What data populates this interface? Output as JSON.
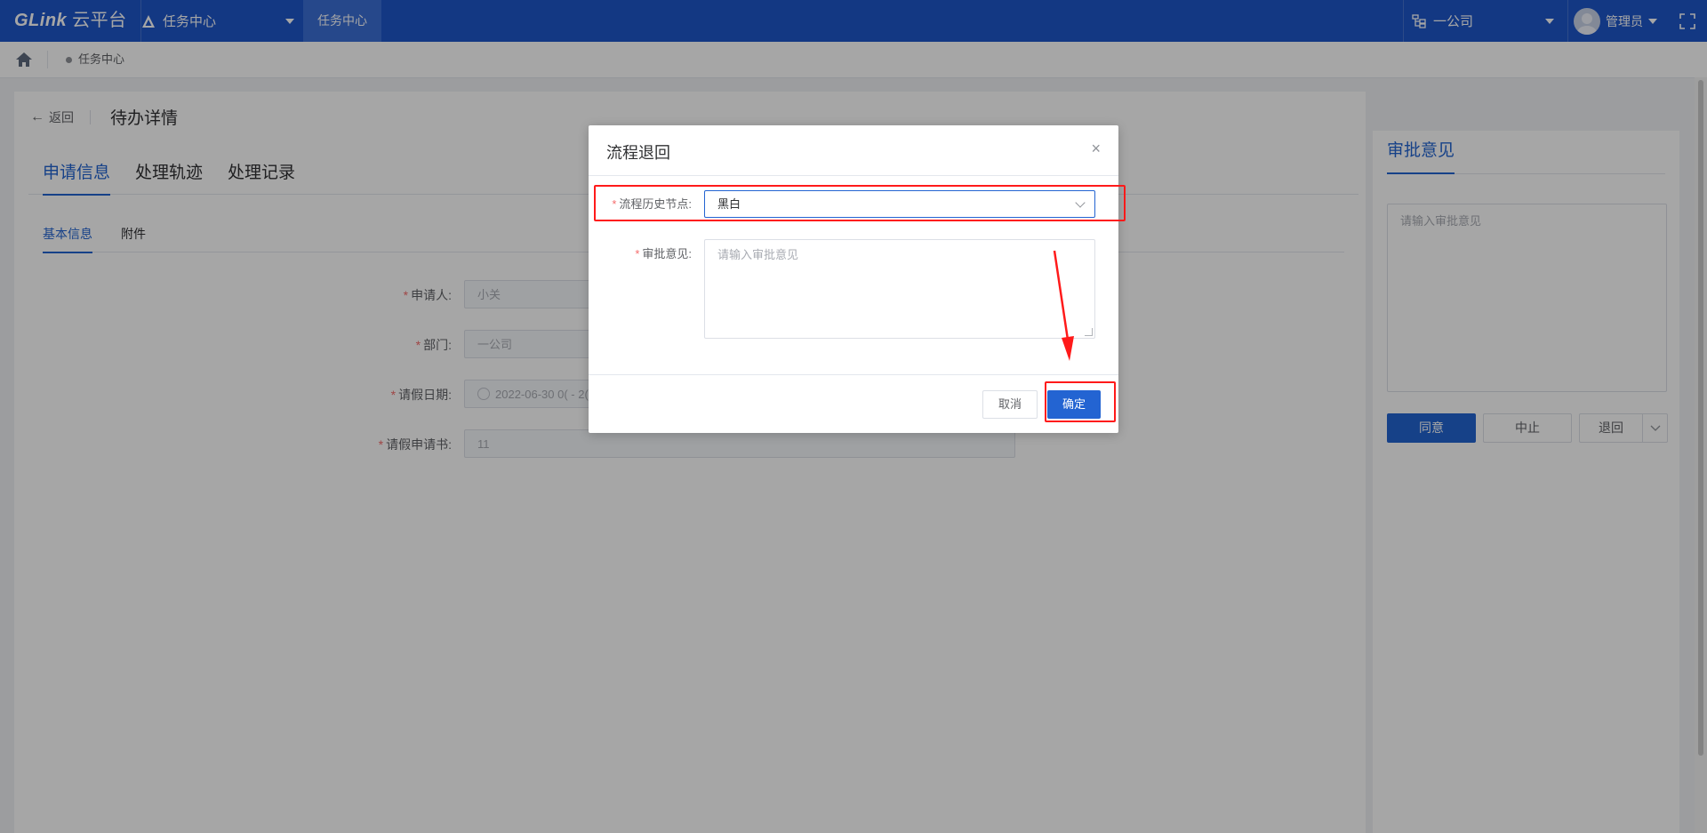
{
  "topbar": {
    "logo": "GLink",
    "logo_sub": "云平台",
    "module_select": "任务中心",
    "active_tab": "任务中心",
    "org_select": "一公司",
    "user_name": "管理员"
  },
  "breadcrumb": {
    "current": "任务中心"
  },
  "page": {
    "back_label": "返回",
    "title": "待办详情",
    "tabs": [
      {
        "label": "申请信息",
        "active": true
      },
      {
        "label": "处理轨迹",
        "active": false
      },
      {
        "label": "处理记录",
        "active": false
      }
    ],
    "subtabs": [
      {
        "label": "基本信息",
        "active": true
      },
      {
        "label": "附件",
        "active": false
      }
    ],
    "form": [
      {
        "label": "申请人:",
        "value": "小关"
      },
      {
        "label": "部门:",
        "value": "一公司"
      },
      {
        "label": "请假日期:",
        "value": "2022-06-30 0( - 2("
      },
      {
        "label": "请假申请书:",
        "value": "11"
      }
    ]
  },
  "right_panel": {
    "title": "审批意见",
    "placeholder": "请输入审批意见",
    "buttons": {
      "agree": "同意",
      "stop": "中止",
      "return": "退回"
    }
  },
  "dialog": {
    "title": "流程退回",
    "close": "×",
    "history_node_label": "流程历史节点:",
    "history_node_value": "黑白",
    "opinion_label": "审批意见:",
    "opinion_placeholder": "请输入审批意见",
    "cancel_label": "取消",
    "ok_label": "确定"
  },
  "colors": {
    "primary": "#2364d2",
    "topbar": "#1e56c9",
    "highlight": "#ff1a1a"
  }
}
